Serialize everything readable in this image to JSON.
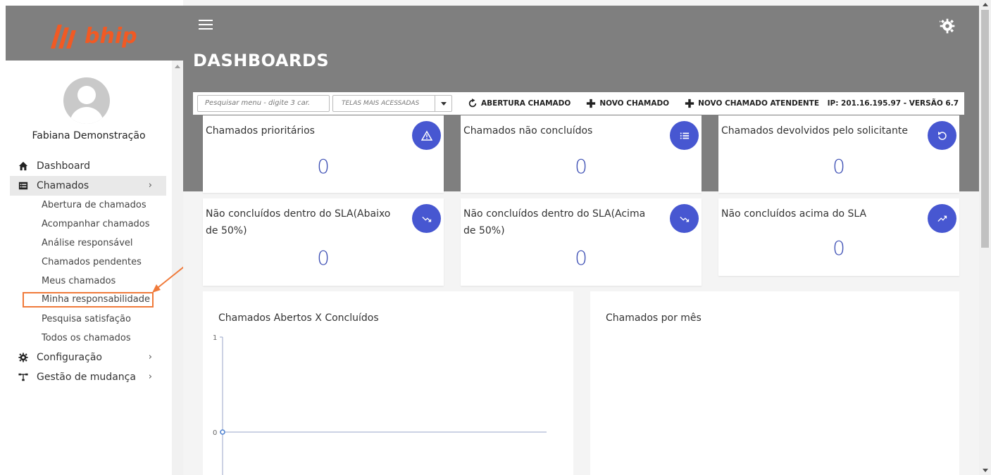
{
  "brand": {
    "name": "bhip",
    "color": "#f15a24"
  },
  "user": {
    "name": "Fabiana Demonstração"
  },
  "sidebar": {
    "items": [
      {
        "label": "Dashboard",
        "icon": "home-icon"
      },
      {
        "label": "Chamados",
        "icon": "list-icon",
        "expanded": true,
        "children": [
          "Abertura de chamados",
          "Acompanhar chamados",
          "Análise responsável",
          "Chamados pendentes",
          "Meus chamados",
          "Minha responsabilidade",
          "Pesquisa satisfação",
          "Todos os chamados"
        ]
      },
      {
        "label": "Configuração",
        "icon": "gear-icon"
      },
      {
        "label": "Gestão de mudança",
        "icon": "flow-icon"
      }
    ],
    "highlighted_child": "Minha responsabilidade"
  },
  "header": {
    "title": "DASHBOARDS"
  },
  "toolbar": {
    "search_placeholder": "Pesquisar menu - digite 3 car.",
    "select_value": "TELAS MAIS ACESSADAS",
    "btn_abertura": "ABERTURA CHAMADO",
    "btn_novo": "NOVO CHAMADO",
    "btn_novo_atendente": "NOVO CHAMADO ATENDENTE",
    "ip_version": "IP: 201.16.195.97 - VERSÃO 6.7"
  },
  "cards": [
    {
      "title": "Chamados prioritários",
      "value": "0",
      "icon": "warning-icon"
    },
    {
      "title": "Chamados não concluídos",
      "value": "0",
      "icon": "list-icon"
    },
    {
      "title": "Chamados devolvidos pelo solicitante",
      "value": "0",
      "icon": "undo-icon"
    },
    {
      "title": "Não concluídos dentro do SLA(Abaixo de 50%)",
      "value": "0",
      "icon": "trend-down-icon"
    },
    {
      "title": "Não concluídos dentro do SLA(Acima de 50%)",
      "value": "0",
      "icon": "trend-down-icon"
    },
    {
      "title": "Não concluídos acima do SLA",
      "value": "0",
      "icon": "trend-up-icon"
    }
  ],
  "panels": {
    "left_title": "Chamados Abertos X Concluídos",
    "right_title": "Chamados por mês"
  },
  "colors": {
    "badge": "#4757d1",
    "value": "#3f51b5",
    "header": "#7f7f7f",
    "highlight": "#f07a3a"
  },
  "chart_data": {
    "type": "line",
    "title": "Chamados Abertos X Concluídos",
    "x": [
      ""
    ],
    "series": [
      {
        "values": [
          0
        ]
      }
    ],
    "ylim": [
      0,
      1
    ],
    "y_ticks": [
      "0",
      "1"
    ],
    "xlabel": "",
    "ylabel": ""
  }
}
